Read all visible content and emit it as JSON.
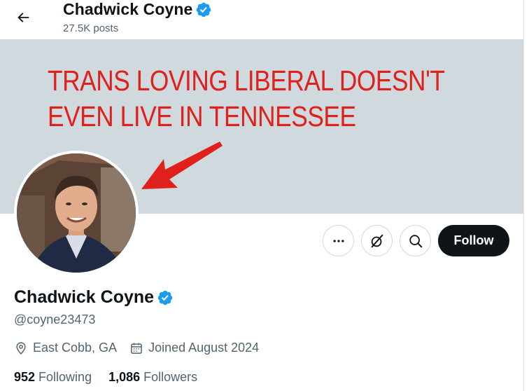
{
  "header": {
    "back_icon": "arrow-left-icon",
    "name": "Chadwick Coyne",
    "posts_count": "27.5K posts"
  },
  "banner": {
    "annotation_line1": "TRANS LOVING LIBERAL DOESN'T",
    "annotation_line2": "EVEN LIVE IN TENNESSEE",
    "annotation_color": "#e0201b",
    "background_color": "#cfd9de"
  },
  "actions": {
    "more_icon": "more-horizontal-icon",
    "grok_icon": "grok-icon",
    "search_icon": "search-icon",
    "follow_label": "Follow"
  },
  "profile": {
    "name": "Chadwick Coyne",
    "handle": "@coyne23473",
    "location": "East Cobb, GA",
    "joined": "Joined August 2024",
    "following_count": "952",
    "following_label": "Following",
    "followers_count": "1,086",
    "followers_label": "Followers",
    "verified_color": "#1d9bf0"
  }
}
